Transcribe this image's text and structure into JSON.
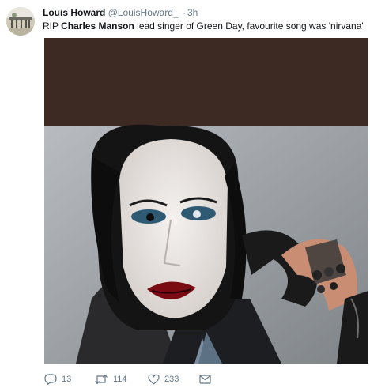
{
  "tweet": {
    "name": "Louis Howard",
    "handle": "@LouisHoward_",
    "separator": "·",
    "time": "3h",
    "text_before": "RIP ",
    "text_bold": "Charles Manson",
    "text_after": " lead singer of Green Day, favourite song was 'nirvana'"
  },
  "actions": {
    "replies": "13",
    "retweets": "114",
    "likes": "233"
  },
  "colors": {
    "text": "#14171a",
    "muted": "#657786",
    "photo_top": "#3c2a23"
  },
  "icons": [
    "reply-icon",
    "retweet-icon",
    "heart-icon",
    "envelope-icon"
  ]
}
